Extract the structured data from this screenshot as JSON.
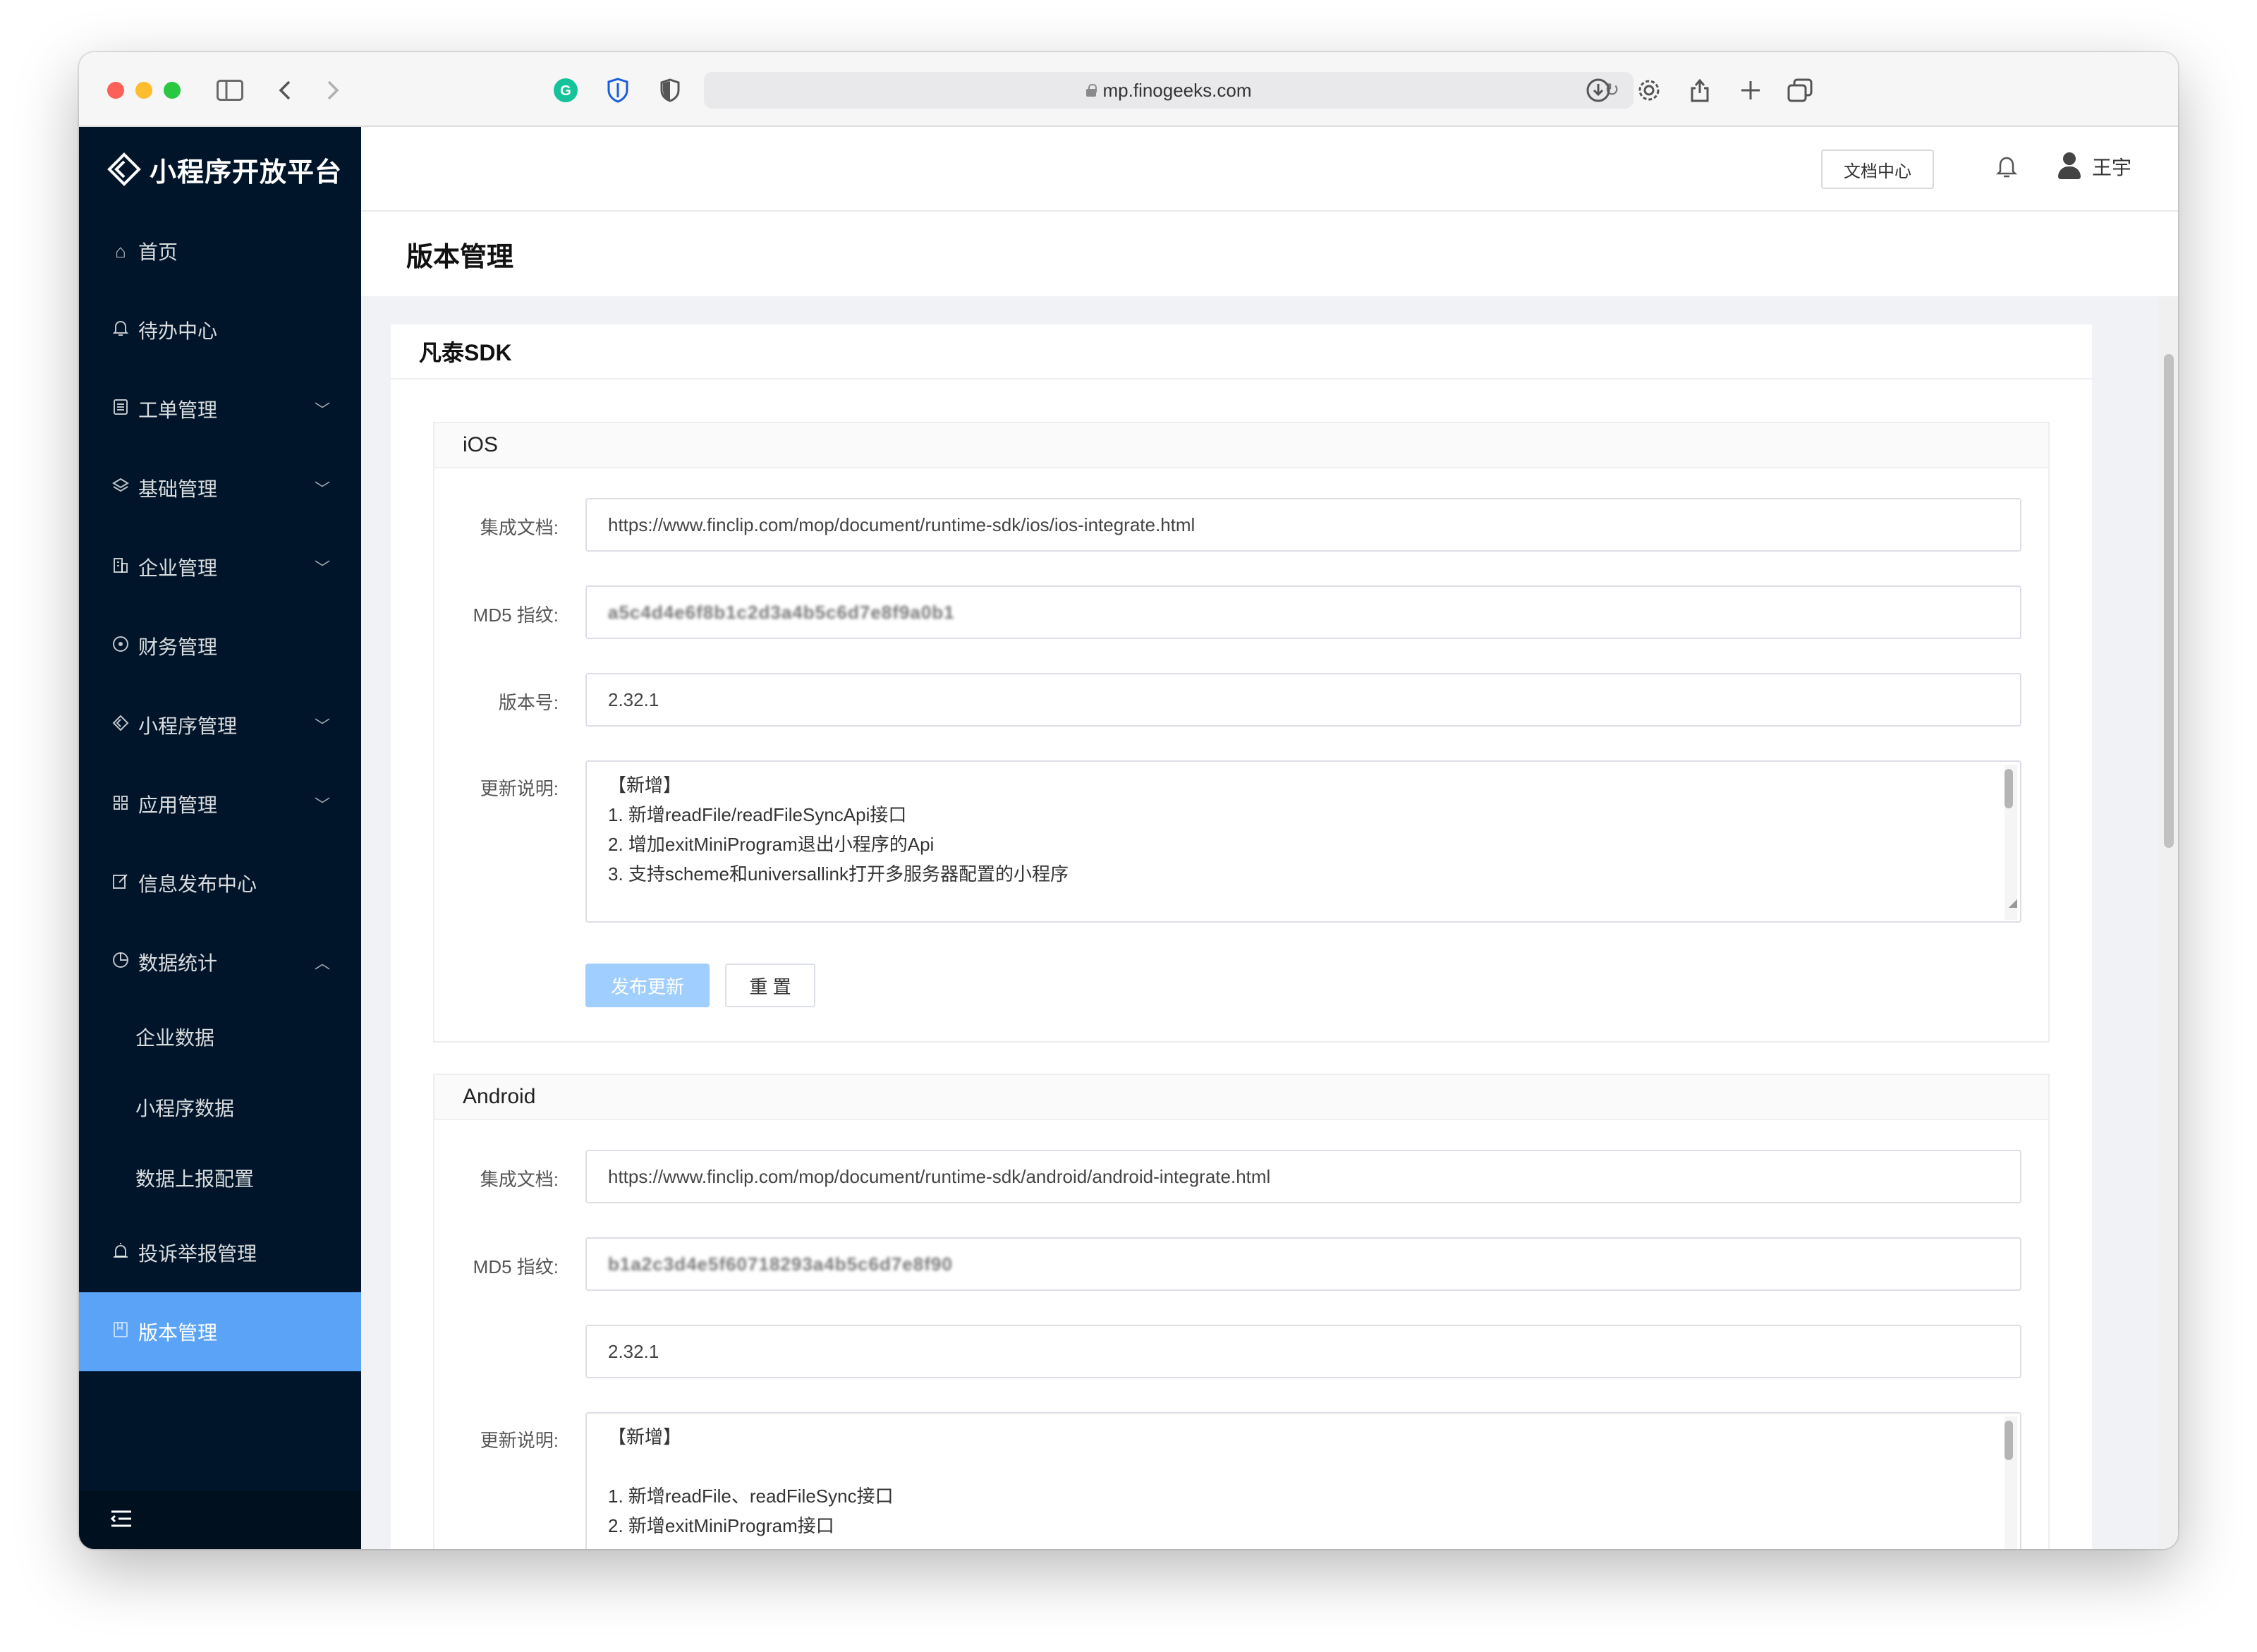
{
  "browser": {
    "url": "mp.finogeeks.com"
  },
  "app": {
    "title": "小程序开放平台"
  },
  "sidebar": {
    "items": [
      {
        "label": "首页",
        "icon": "home-icon"
      },
      {
        "label": "待办中心",
        "icon": "bell-icon"
      },
      {
        "label": "工单管理",
        "icon": "clipboard-icon",
        "expandable": true
      },
      {
        "label": "基础管理",
        "icon": "layers-icon",
        "expandable": true
      },
      {
        "label": "企业管理",
        "icon": "building-icon",
        "expandable": true
      },
      {
        "label": "财务管理",
        "icon": "coin-icon"
      },
      {
        "label": "小程序管理",
        "icon": "diamond-icon",
        "expandable": true
      },
      {
        "label": "应用管理",
        "icon": "grid-icon",
        "expandable": true
      },
      {
        "label": "信息发布中心",
        "icon": "edit-icon"
      },
      {
        "label": "数据统计",
        "icon": "pie-chart-icon",
        "expanded": true
      }
    ],
    "sub_items": [
      "企业数据",
      "小程序数据",
      "数据上报配置"
    ],
    "items_after": [
      {
        "label": "投诉举报管理",
        "icon": "alarm-icon"
      },
      {
        "label": "版本管理",
        "icon": "bookmark-icon",
        "active": true
      }
    ]
  },
  "header": {
    "doc_button": "文档中心",
    "user_name": "王宇"
  },
  "page": {
    "title": "版本管理",
    "card_title": "凡泰SDK"
  },
  "ios": {
    "section": "iOS",
    "doc_label": "集成文档:",
    "doc_url": "https://www.finclip.com/mop/document/runtime-sdk/ios/ios-integrate.html",
    "md5_label": "MD5 指纹:",
    "md5_value": "a5c4d4e6f8b1c2d3a4b5c6d7e8f9a0b1",
    "version_label": "版本号:",
    "version": "2.32.1",
    "notes_label": "更新说明:",
    "notes": [
      "【新增】",
      "1. 新增readFile/readFileSyncApi接口",
      "2. 增加exitMiniProgram退出小程序的Api",
      "3. 支持scheme和universallink打开多服务器配置的小程序"
    ],
    "publish_button": "发布更新",
    "reset_button": "重 置"
  },
  "android": {
    "section": "Android",
    "doc_label": "集成文档:",
    "doc_url": "https://www.finclip.com/mop/document/runtime-sdk/android/android-integrate.html",
    "md5_label": "MD5 指纹:",
    "md5_value": "b1a2c3d4e5f60718293a4b5c6d7e8f90",
    "version": "2.32.1",
    "notes_label": "更新说明:",
    "notes": [
      "【新增】",
      "",
      "1. 新增readFile、readFileSync接口",
      "2. 新增exitMiniProgram接口"
    ]
  }
}
